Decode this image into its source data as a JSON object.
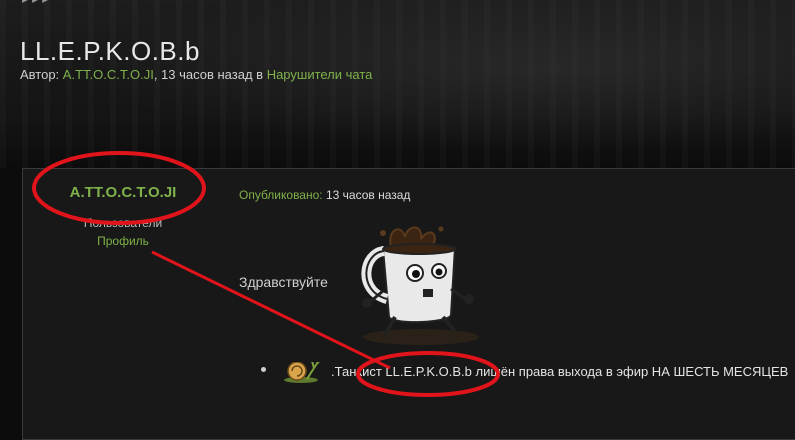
{
  "topic": {
    "title": "LL.E.P.K.O.B.b",
    "meta_author_label": "Автор:",
    "meta_author": "A.TT.O.C.T.O.JI",
    "meta_time": ", 13 часов назад в",
    "meta_forum": "Нарушители чата"
  },
  "post": {
    "author": "A.TT.O.C.T.O.JI",
    "group": "Пользователи",
    "profile_link": "Профиль",
    "published_label": "Опубликовано:",
    "published_time": "13 часов назад",
    "greeting": "Здравствуйте",
    "bullet_text": ".Танкист LL.E.P.K.O.B.b лишён права выхода в эфир НА ШЕСТЬ МЕСЯЦЕВ"
  },
  "colors": {
    "accent": "#7fb24a",
    "annotation": "#e0141a",
    "background": "#0c0c0c",
    "panel": "#181818"
  }
}
